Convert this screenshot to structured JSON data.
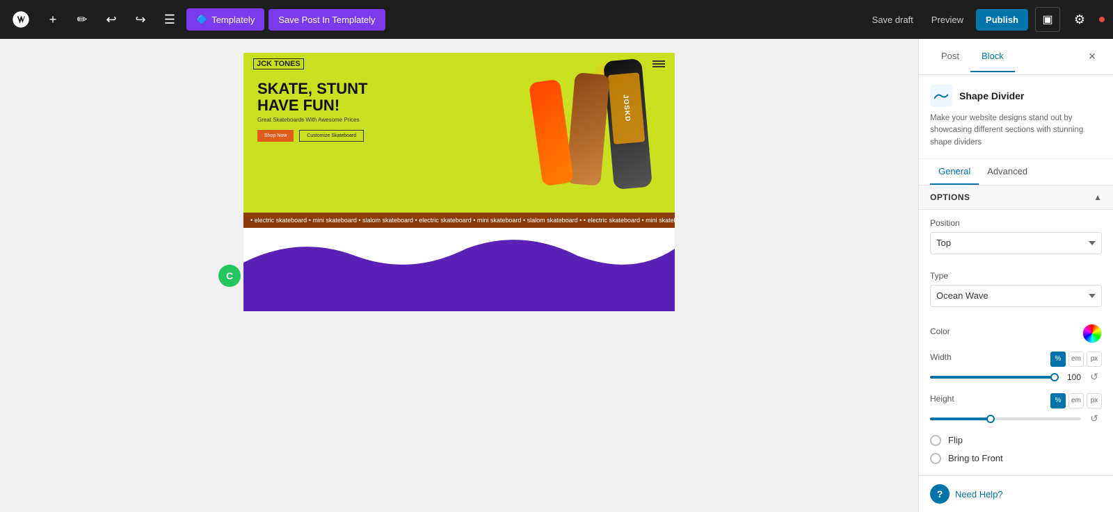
{
  "toolbar": {
    "templately_label": "Templately",
    "save_templately_label": "Save Post In Templately",
    "save_draft_label": "Save draft",
    "preview_label": "Preview",
    "publish_label": "Publish"
  },
  "panel": {
    "post_tab": "Post",
    "block_tab": "Block",
    "close_label": "×",
    "shape_divider": {
      "title": "Shape Divider",
      "description": "Make your website designs stand out by showcasing different sections with stunning shape dividers"
    },
    "tabs": {
      "general": "General",
      "advanced": "Advanced"
    },
    "options": {
      "header": "Options",
      "position_label": "Position",
      "position_value": "Top",
      "type_label": "Type",
      "type_value": "Ocean Wave",
      "color_label": "Color",
      "width_label": "Width",
      "width_value": "100",
      "height_label": "Height",
      "flip_label": "Flip",
      "bring_front_label": "Bring to Front"
    }
  },
  "canvas": {
    "skate": {
      "logo": "JCK TONES",
      "title_line1": "SKATE, STUNT",
      "title_line2": "HAVE FUN!",
      "subtitle": "Great Skateboards With Awesome Prices",
      "btn1": "Shop Now",
      "btn2": "Customize Skateboard"
    },
    "ticker_text": "• electric skateboard • mini skateboard • slalom skateboard • electric skateboard • mini skateboard • slalom skateboard •"
  },
  "icons": {
    "add": "+",
    "pencil": "✏",
    "undo": "↩",
    "redo": "↪",
    "list": "☰",
    "dots": "⋮",
    "sidebar": "▣",
    "settings": "⚙",
    "up_arrow": "▲",
    "chevron_down": "⌄",
    "reset": "↺",
    "help": "?"
  }
}
